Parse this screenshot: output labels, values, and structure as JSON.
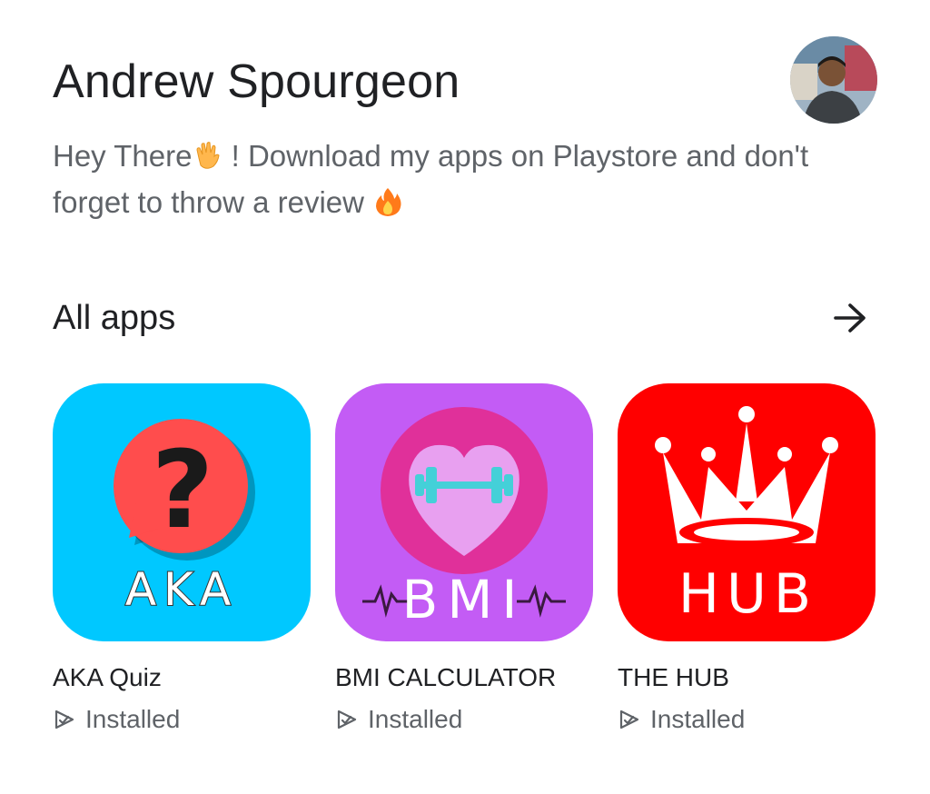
{
  "developer": {
    "name": "Andrew Spourgeon",
    "description_part1": "Hey There",
    "description_part2": " ! Download my apps on Playstore and don't forget to throw a review ",
    "avatar_icon": "profile-photo"
  },
  "section": {
    "title": "All apps",
    "arrow_icon": "arrow-right-icon"
  },
  "apps": [
    {
      "name": "AKA Quiz",
      "status": "Installed",
      "icon_text": "AKA",
      "icon_color": "#00c8ff"
    },
    {
      "name": "BMI CALCULATOR",
      "status": "Installed",
      "icon_text": "BMI",
      "icon_color": "#c35cf5"
    },
    {
      "name": "THE HUB",
      "status": "Installed",
      "icon_text": "HUB",
      "icon_color": "#ff0000"
    }
  ],
  "colors": {
    "primary_text": "#202124",
    "secondary_text": "#5f6368",
    "background": "#ffffff"
  }
}
